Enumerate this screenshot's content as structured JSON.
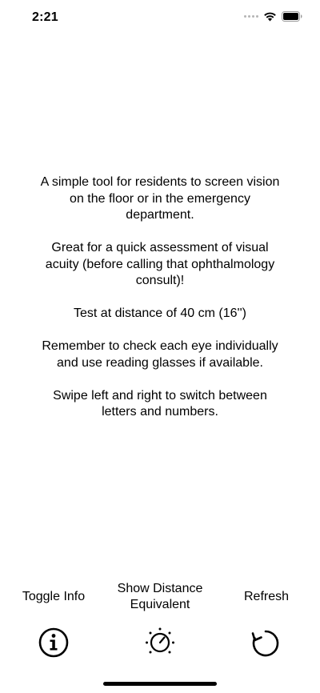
{
  "status_bar": {
    "time": "2:21",
    "icons": [
      "cellular-dots-icon",
      "wifi-icon",
      "battery-icon"
    ]
  },
  "info": {
    "paragraphs": [
      "A simple tool for residents to screen vision on the floor or in the emergency department.",
      "Great for a quick assessment of visual acuity (before calling that ophthalmology consult)!",
      "Test at distance of 40 cm (16'')",
      "Remember to check each eye individually and use reading glasses if available.",
      "Swipe left and right to switch between letters and numbers."
    ]
  },
  "toolbar": {
    "toggle_info_label": "Toggle Info",
    "show_distance_label_line1": "Show Distance",
    "show_distance_label_line2": "Equivalent",
    "refresh_label": "Refresh",
    "icons": [
      "info-icon",
      "dial-icon",
      "refresh-icon"
    ]
  },
  "colors": {
    "background": "#ffffff",
    "text": "#000000"
  }
}
